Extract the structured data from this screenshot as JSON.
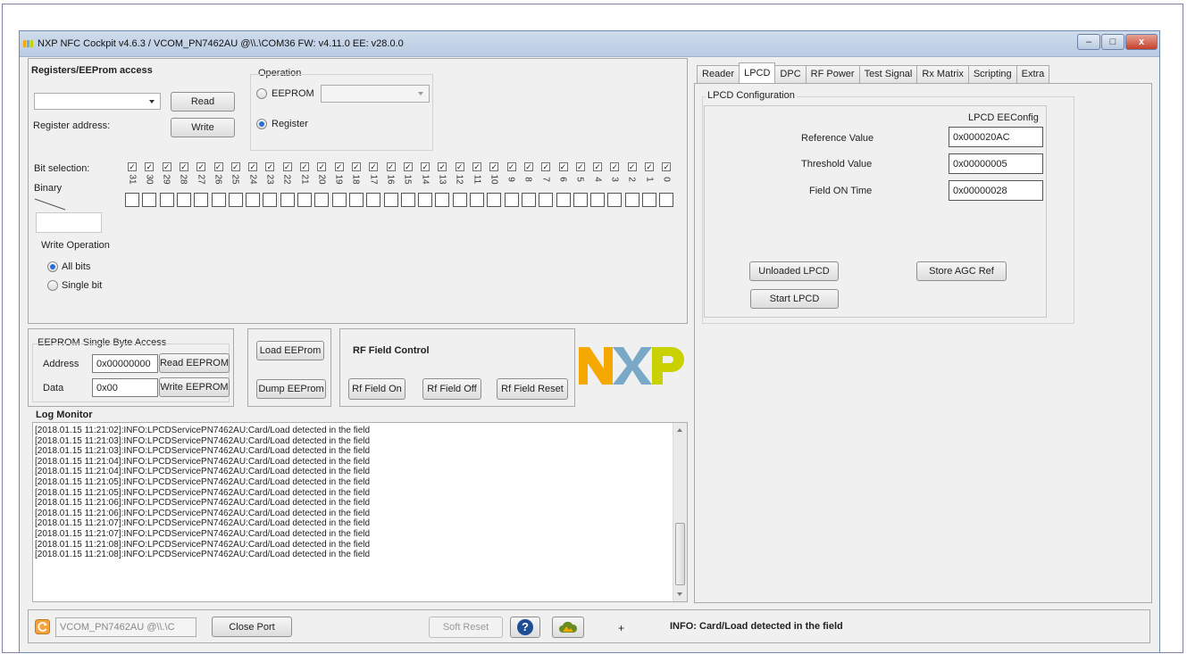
{
  "window": {
    "title": "NXP NFC Cockpit v4.6.3 / VCOM_PN7462AU @\\\\.\\COM36  FW: v4.11.0  EE: v28.0.0",
    "controls": [
      "–",
      "□",
      "x"
    ]
  },
  "registers": {
    "heading": "Registers/EEProm access",
    "read_label": "Read",
    "write_label": "Write",
    "register_address_label": "Register address:",
    "bit_selection_label": "Bit selection:",
    "binary_label": "Binary",
    "bits": [
      "31",
      "30",
      "29",
      "28",
      "27",
      "26",
      "25",
      "24",
      "23",
      "22",
      "21",
      "20",
      "19",
      "18",
      "17",
      "16",
      "15",
      "14",
      "13",
      "12",
      "11",
      "10",
      "9",
      "8",
      "7",
      "6",
      "5",
      "4",
      "3",
      "2",
      "1",
      "0"
    ],
    "bit_checked": true,
    "write_operation": {
      "label": "Write Operation",
      "options": [
        "All bits",
        "Single bit"
      ],
      "selected": "All bits"
    }
  },
  "operation": {
    "label": "Operation",
    "eeprom_label": "EEPROM",
    "register_label": "Register",
    "selected": "Register"
  },
  "eeprom_single": {
    "label": "EEPROM Single Byte Access",
    "address_label": "Address",
    "address_value": "0x00000000",
    "data_label": "Data",
    "data_value": "0x00",
    "read_button": "Read EEPROM",
    "write_button": "Write EEPROM"
  },
  "eeprom_actions": {
    "load": "Load EEProm",
    "dump": "Dump EEProm"
  },
  "rf_field": {
    "label": "RF Field Control",
    "on": "Rf Field On",
    "off": "Rf Field Off",
    "reset": "Rf Field Reset"
  },
  "logo": {
    "text": "NXP",
    "colors": {
      "n": "#f5a800",
      "x": "#7aa9c8",
      "p": "#c9d200"
    }
  },
  "log": {
    "heading": "Log Monitor",
    "lines": [
      "[2018.01.15 11:21:02]:INFO:LPCDServicePN7462AU:Card/Load detected in the field",
      "[2018.01.15 11:21:03]:INFO:LPCDServicePN7462AU:Card/Load detected in the field",
      "[2018.01.15 11:21:03]:INFO:LPCDServicePN7462AU:Card/Load detected in the field",
      "[2018.01.15 11:21:04]:INFO:LPCDServicePN7462AU:Card/Load detected in the field",
      "[2018.01.15 11:21:04]:INFO:LPCDServicePN7462AU:Card/Load detected in the field",
      "[2018.01.15 11:21:05]:INFO:LPCDServicePN7462AU:Card/Load detected in the field",
      "[2018.01.15 11:21:05]:INFO:LPCDServicePN7462AU:Card/Load detected in the field",
      "[2018.01.15 11:21:06]:INFO:LPCDServicePN7462AU:Card/Load detected in the field",
      "[2018.01.15 11:21:06]:INFO:LPCDServicePN7462AU:Card/Load detected in the field",
      "[2018.01.15 11:21:07]:INFO:LPCDServicePN7462AU:Card/Load detected in the field",
      "[2018.01.15 11:21:07]:INFO:LPCDServicePN7462AU:Card/Load detected in the field",
      "[2018.01.15 11:21:08]:INFO:LPCDServicePN7462AU:Card/Load detected in the field",
      "[2018.01.15 11:21:08]:INFO:LPCDServicePN7462AU:Card/Load detected in the field"
    ]
  },
  "tabs": [
    "Reader",
    "LPCD",
    "DPC",
    "RF Power",
    "Test Signal",
    "Rx Matrix",
    "Scripting",
    "Extra"
  ],
  "active_tab": "LPCD",
  "lpcd": {
    "group_label": "LPCD Configuration",
    "column_header": "LPCD EEConfig",
    "reference_label": "Reference Value",
    "reference_value": "0x000020AC",
    "threshold_label": "Threshold Value",
    "threshold_value": "0x00000005",
    "field_on_label": "Field ON Time",
    "field_on_value": "0x00000028",
    "unloaded_button": "Unloaded LPCD",
    "store_agc_button": "Store AGC Ref",
    "start_button": "Start LPCD"
  },
  "status": {
    "port": "VCOM_PN7462AU @\\\\.\\C",
    "close_port": "Close Port",
    "soft_reset": "Soft Reset",
    "help_icon": "?",
    "plus": "+",
    "message": "INFO: Card/Load detected in the field"
  }
}
